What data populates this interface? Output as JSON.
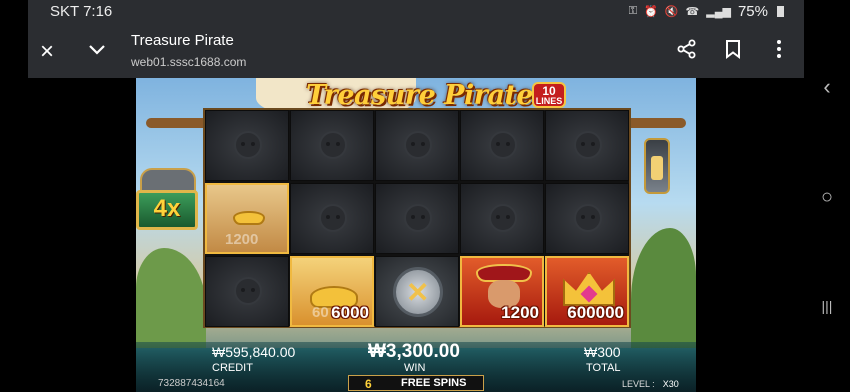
{
  "status_bar": {
    "carrier_time": "SKT 7:16",
    "battery": "75%",
    "icons": [
      "key-icon",
      "alarm-icon",
      "mute-icon",
      "wifi-call-icon",
      "signal-icon",
      "battery-icon"
    ]
  },
  "browser": {
    "title": "Treasure Pirate",
    "url": "web01.sssc1688.com",
    "close_icon": "×",
    "actions": [
      "share-icon",
      "bookmark-icon",
      "more-vert-icon"
    ]
  },
  "game": {
    "logo": "Treasure Pirate",
    "lines_count": "10",
    "lines_label": "LINES",
    "multiplier": "4x",
    "reels": {
      "amounts": {
        "r1c2": "1200",
        "r2c1": "6000",
        "r2c1_faded": "60",
        "r2c3": "1200",
        "r2c4": "600000"
      }
    },
    "credit_value": "₩595,840.00",
    "credit_label": "CREDIT",
    "win_value": "₩3,300.00",
    "win_label": "WIN",
    "total_value": "₩300",
    "total_label": "TOTAL",
    "round_id": "732887434164",
    "free_spins_count": "6",
    "free_spins_label": "FREE SPINS",
    "level_label": "LEVEL :",
    "level_value": "X30"
  },
  "android_nav": {
    "back": "‹",
    "home": "○",
    "recents": "|||"
  }
}
